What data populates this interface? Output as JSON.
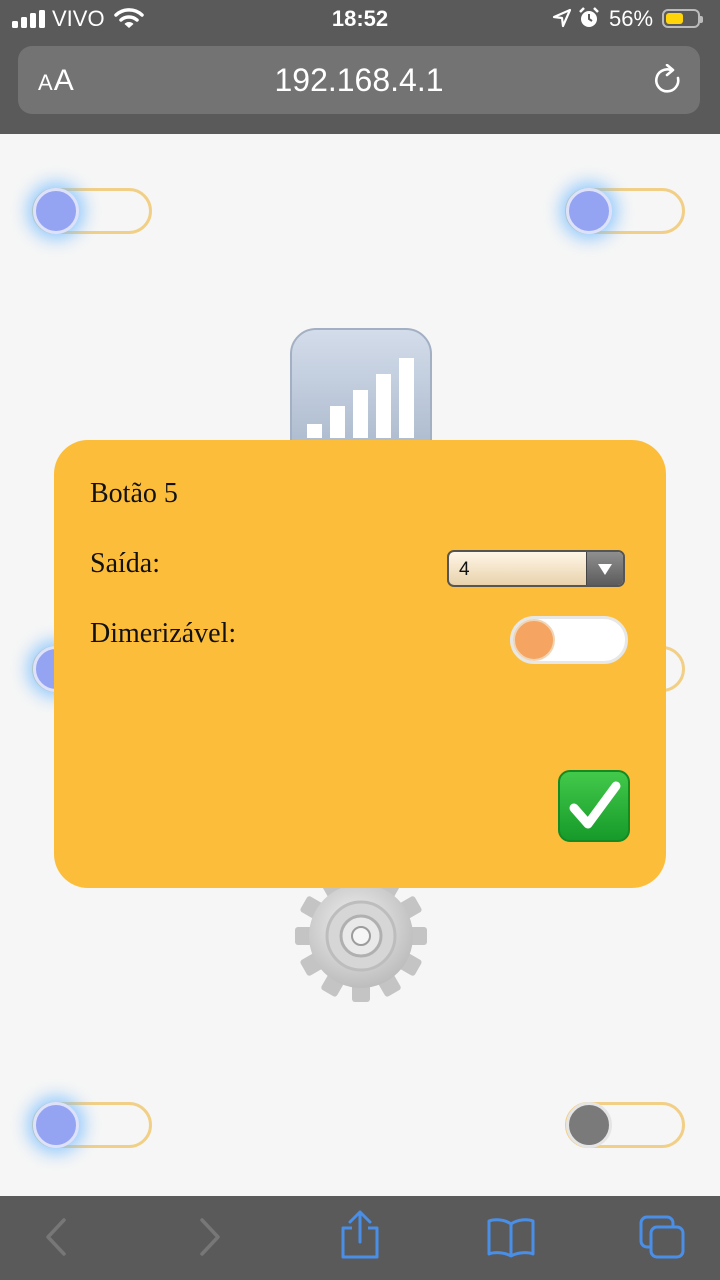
{
  "status_bar": {
    "carrier": "VIVO",
    "time": "18:52",
    "battery_percent": "56%",
    "battery_level": 0.56,
    "icons": [
      "signal-icon",
      "wifi-icon",
      "location-icon",
      "alarm-icon",
      "battery-icon"
    ]
  },
  "browser": {
    "text_size_label": "AA",
    "url": "192.168.4.1",
    "icons": [
      "reload-icon"
    ]
  },
  "background_controls": {
    "toggles": [
      {
        "name": "toggle-top-left",
        "on": true
      },
      {
        "name": "toggle-top-right",
        "on": true
      },
      {
        "name": "toggle-bottom-left",
        "on": true
      },
      {
        "name": "toggle-bottom-right",
        "on": false
      }
    ],
    "icons": [
      "bar-chart-icon",
      "gear-icon"
    ]
  },
  "dialog": {
    "title": "Botão 5",
    "output_label": "Saída:",
    "output_value": "4",
    "dimmable_label": "Dimerizável:",
    "dimmable_on": false,
    "confirm_icon": "check-mark-icon"
  },
  "toolbar": {
    "icons": [
      "back-icon",
      "forward-icon",
      "share-icon",
      "bookmarks-icon",
      "tabs-icon"
    ],
    "accent_color": "#4a8fe7"
  },
  "colors": {
    "dialog_bg": "#fcbe3a",
    "toggle_knob_on": "#94a4f3",
    "toggle_track_border": "#f2cf86",
    "switch_knob": "#f5a462"
  }
}
